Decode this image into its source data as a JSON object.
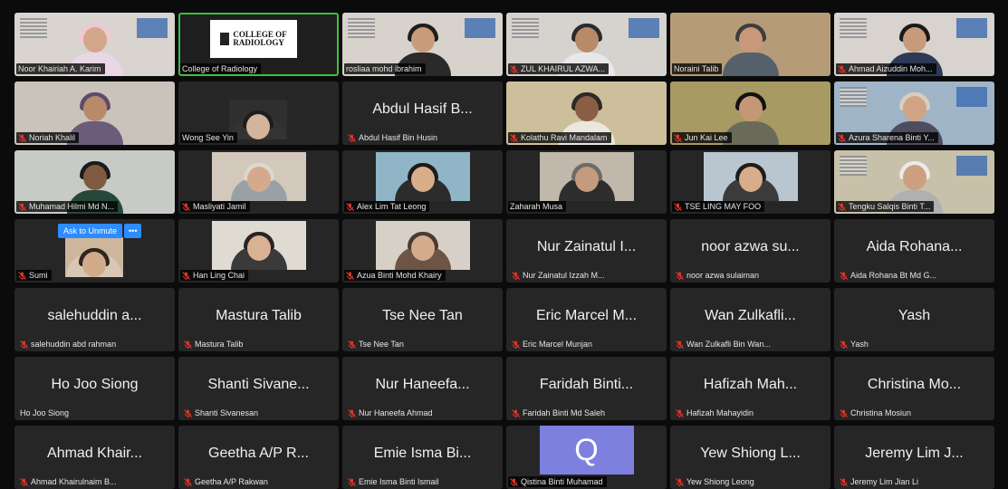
{
  "participants": [
    {
      "name": "Noor Khairiah A. Karim",
      "bg": "#d9d4cf",
      "style": "banner",
      "skin": "#d2a78a",
      "hair": "#f3c6d5",
      "top": "#e9d7e5",
      "muted": false
    },
    {
      "name": "College of Radiology",
      "style": "logo",
      "logo_text": [
        "COLLEGE OF",
        "RADIOLOGY"
      ],
      "muted": false,
      "active": true
    },
    {
      "name": "rosliaa mohd ibrahim",
      "bg": "#d7d2cc",
      "style": "banner",
      "skin": "#c89b7a",
      "hair": "#1e1e1e",
      "top": "#2a2a2a",
      "muted": false
    },
    {
      "name": "ZUL KHAIRUL AZWA...",
      "bg": "#d6d2cd",
      "style": "banner",
      "skin": "#b98a67",
      "hair": "#2a2a2a",
      "top": "#e8e8e8",
      "muted": true
    },
    {
      "name": "Noraini Talib",
      "bg": "#b69b79",
      "style": "video",
      "skin": "#c9977a",
      "hair": "#3d3d3d",
      "top": "#55606b",
      "muted": false
    },
    {
      "name": "Ahmad Aizuddin Moh...",
      "bg": "#d8d3ce",
      "style": "banner",
      "skin": "#c79a7a",
      "hair": "#1a1a1a",
      "top": "#2e3a55",
      "muted": true
    },
    {
      "name": "Noriah Khalil",
      "bg": "#c9c3bb",
      "style": "video",
      "skin": "#b88a6a",
      "hair": "#5e4a6b",
      "top": "#6b5d7a",
      "muted": true
    },
    {
      "name": "Wong See Yin",
      "style": "small",
      "skin": "#d4b49a",
      "hair": "#1d1d1d",
      "top": "#333",
      "muted": false
    },
    {
      "name": "Abdul Hasif Bin Husin",
      "big": "Abdul Hasif B...",
      "muted": true
    },
    {
      "name": "Kolathu Ravi Mandalam",
      "bg": "#cdbf9b",
      "style": "video",
      "skin": "#8a5e45",
      "hair": "#2a2a2a",
      "top": "#ece7dd",
      "muted": true
    },
    {
      "name": "Jun Kai Lee",
      "bg": "#a79a62",
      "style": "video",
      "skin": "#c49877",
      "hair": "#121212",
      "top": "#6a6a5a",
      "muted": true
    },
    {
      "name": "Azura Sharena Binti Y...",
      "bg": "#9fb4c7",
      "style": "banner",
      "skin": "#cfa383",
      "hair": "#d9cdbf",
      "top": "#4d4d60",
      "muted": true
    },
    {
      "name": "Muhamad Hilmi Md N...",
      "bg": "#c7cbc6",
      "style": "video",
      "skin": "#7f5a40",
      "hair": "#1b1b1b",
      "top": "#26483a",
      "muted": true
    },
    {
      "name": "Masliyati Jamil",
      "style": "framed",
      "bg": "#d2c8bb",
      "skin": "#d3ab8c",
      "hair": "#dcd7cf",
      "top": "#9aa1a6",
      "muted": true
    },
    {
      "name": "Alex Lim Tat Leong",
      "style": "framed",
      "bg": "#8fb5c6",
      "skin": "#d8ad8a",
      "hair": "#1b1b1b",
      "top": "#2c2c2c",
      "muted": true
    },
    {
      "name": "Zaharah Musa",
      "style": "framed",
      "bg": "#bfb8ab",
      "skin": "#c49b7d",
      "hair": "#6b6b6b",
      "top": "#2d2d2d",
      "muted": false
    },
    {
      "name": "TSE LING MAY FOO",
      "style": "framed",
      "bg": "#b9c6d0",
      "skin": "#d7ad8b",
      "hair": "#1c1c1c",
      "top": "#3b3b3b",
      "muted": true
    },
    {
      "name": "Tengku Salqis Binti T...",
      "bg": "#c7c1a9",
      "style": "banner",
      "skin": "#cc9f7f",
      "hair": "#eaeaea",
      "top": "#b0b0b0",
      "muted": true
    },
    {
      "name": "Sumi",
      "style": "unmute",
      "skin": "#d1ab8a",
      "hair": "#2f2520",
      "top": "#d8c7b5",
      "muted": true,
      "unmute_label": "Ask to Unmute",
      "more_label": "•••"
    },
    {
      "name": "Han Ling Chai",
      "style": "framed",
      "bg": "#dfdad2",
      "skin": "#d9b193",
      "hair": "#2a2321",
      "top": "#3a3a3a",
      "muted": true
    },
    {
      "name": "Azua Binti Mohd Khairy",
      "style": "framed",
      "bg": "#d6d0c6",
      "skin": "#d4ab8c",
      "hair": "#4a3a33",
      "top": "#6e5445",
      "muted": true
    },
    {
      "name": "Nur Zainatul Izzah M...",
      "big": "Nur Zainatul I...",
      "muted": true
    },
    {
      "name": "noor azwa sulaiman",
      "big": "noor azwa su...",
      "muted": true
    },
    {
      "name": "Aida Rohana Bt Md G...",
      "big": "Aida Rohana...",
      "muted": true
    },
    {
      "name": "salehuddin abd rahman",
      "big": "salehuddin a...",
      "muted": true
    },
    {
      "name": "Mastura Talib",
      "big": "Mastura Talib",
      "muted": true
    },
    {
      "name": "Tse Nee Tan",
      "big": "Tse Nee Tan",
      "muted": true
    },
    {
      "name": "Eric Marcel Munjan",
      "big": "Eric Marcel M...",
      "muted": true
    },
    {
      "name": "Wan Zulkafli Bin Wan...",
      "big": "Wan Zulkafli...",
      "muted": true
    },
    {
      "name": "Yash",
      "big": "Yash",
      "muted": true
    },
    {
      "name": "Ho Joo Siong",
      "big": "Ho Joo Siong",
      "muted": false
    },
    {
      "name": "Shanti Sivanesan",
      "big": "Shanti Sivane...",
      "muted": true
    },
    {
      "name": "Nur Haneefa Ahmad",
      "big": "Nur Haneefa...",
      "muted": true
    },
    {
      "name": "Faridah Binti Md Saleh",
      "big": "Faridah Binti...",
      "muted": true
    },
    {
      "name": "Hafizah Mahayidin",
      "big": "Hafizah Mah...",
      "muted": true
    },
    {
      "name": "Christina Mosiun",
      "big": "Christina Mo...",
      "muted": true
    },
    {
      "name": "Ahmad Khairulnaim B...",
      "big": "Ahmad Khair...",
      "muted": true
    },
    {
      "name": "Geetha A/P Rakwan",
      "big": "Geetha A/P R...",
      "muted": true
    },
    {
      "name": "Emie Isma Binti Ismail",
      "big": "Emie Isma Bi...",
      "muted": true
    },
    {
      "name": "Qistina Binti Muhamad",
      "style": "avatar",
      "avatar_letter": "Q",
      "avatar_color": "#7d80df",
      "muted": true
    },
    {
      "name": "Yew Shiong Leong",
      "big": "Yew Shiong L...",
      "muted": true
    },
    {
      "name": "Jeremy Lim Jian Li",
      "big": "Jeremy Lim J...",
      "muted": true
    }
  ],
  "colors": {
    "mute_red": "#e0352b",
    "active_border": "#3fbf3f",
    "unmute_blue": "#2d8cff"
  }
}
